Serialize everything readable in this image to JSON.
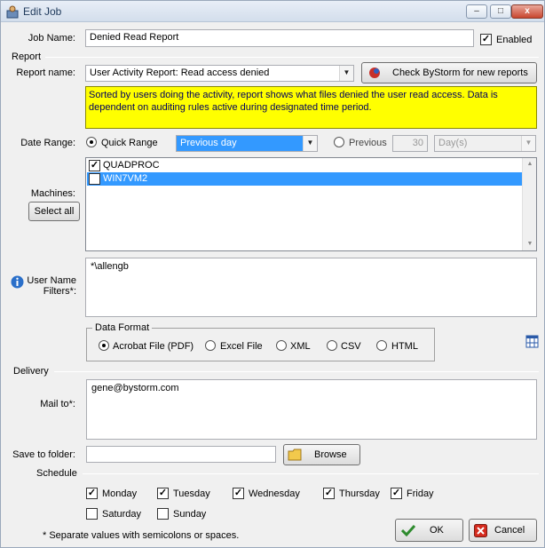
{
  "window": {
    "title": "Edit Job",
    "minimize": "–",
    "maximize": "□",
    "close": "x"
  },
  "job": {
    "name_label": "Job Name:",
    "name_value": "Denied Read Report",
    "enabled_label": "Enabled",
    "enabled": true
  },
  "report": {
    "section_label": "Report",
    "name_label": "Report name:",
    "name_value": "User Activity Report:  Read access denied",
    "check_button": "Check ByStorm for new reports",
    "description": "Sorted by users doing the activity, report shows what files denied the user read access.  Data is dependent on auditing rules active during designated time period."
  },
  "date_range": {
    "label": "Date Range:",
    "quick_label": "Quick Range",
    "quick_value": "Previous day",
    "previous_label": "Previous",
    "previous_value": "30",
    "unit_value": "Day(s)"
  },
  "machines": {
    "label": "Machines:",
    "select_all": "Select all",
    "items": [
      {
        "name": "QUADPROC",
        "checked": true,
        "selected": false
      },
      {
        "name": "WIN7VM2",
        "checked": true,
        "selected": true
      }
    ]
  },
  "user_filter": {
    "label_line1": "User Name",
    "label_line2": "Filters*:",
    "value": "*\\allengb"
  },
  "data_format": {
    "title": "Data Format",
    "options": [
      "Acrobat File (PDF)",
      "Excel File",
      "XML",
      "CSV",
      "HTML"
    ],
    "selected": "Acrobat File (PDF)"
  },
  "delivery": {
    "section_label": "Delivery",
    "mail_label": "Mail to*:",
    "mail_value": "gene@bystorm.com",
    "folder_label": "Save to folder:",
    "folder_value": "",
    "browse": "Browse"
  },
  "schedule": {
    "section_label": "Schedule",
    "days": [
      {
        "name": "Monday",
        "checked": true
      },
      {
        "name": "Tuesday",
        "checked": true
      },
      {
        "name": "Wednesday",
        "checked": true
      },
      {
        "name": "Thursday",
        "checked": true
      },
      {
        "name": "Friday",
        "checked": true
      },
      {
        "name": "Saturday",
        "checked": false
      },
      {
        "name": "Sunday",
        "checked": false
      }
    ]
  },
  "footer": {
    "note": "* Separate values with semicolons or spaces.",
    "ok": "OK",
    "cancel": "Cancel"
  },
  "colors": {
    "selection": "#3399ff",
    "description_bg": "#ffff00",
    "title_text": "#1e395b"
  }
}
